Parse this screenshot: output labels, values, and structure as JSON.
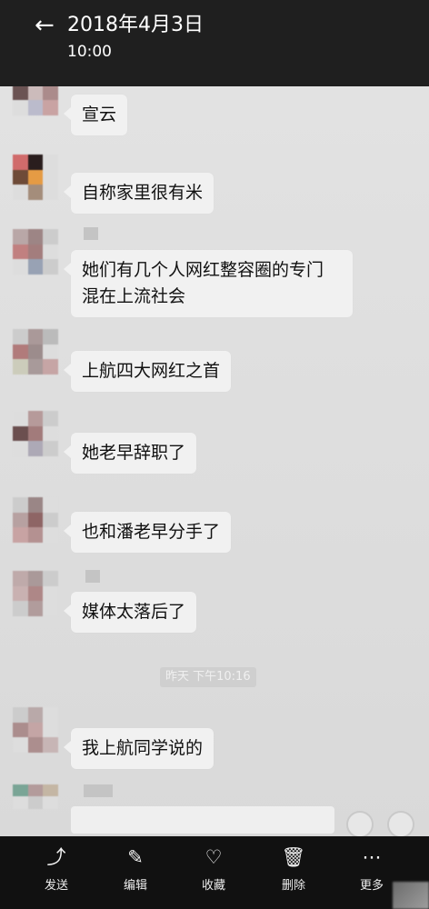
{
  "header": {
    "back_icon": "back-arrow-icon",
    "title": "2018年4月3日",
    "subtitle": "10:00"
  },
  "messages": [
    {
      "text": "宣云"
    },
    {
      "text": "自称家里很有米"
    },
    {
      "text": "她们有几个人网红整容圈的专门\n混在上流社会"
    },
    {
      "text": "上航四大网红之首"
    },
    {
      "text": "她老早辞职了"
    },
    {
      "text": "也和潘老早分手了"
    },
    {
      "text": "媒体太落后了"
    },
    {
      "text": "我上航同学说的"
    }
  ],
  "timestamp": "昨天 下午10:16",
  "actions": [
    {
      "label": "发送",
      "icon": "share-icon"
    },
    {
      "label": "编辑",
      "icon": "edit-icon"
    },
    {
      "label": "收藏",
      "icon": "heart-icon"
    },
    {
      "label": "删除",
      "icon": "trash-icon"
    },
    {
      "label": "更多",
      "icon": "more-icon"
    }
  ],
  "colors": {
    "topbar": "#1f1f1f",
    "chat_background": "#dcdcdc",
    "bubble": "#f1f1f1",
    "bottombar": "#111111"
  }
}
